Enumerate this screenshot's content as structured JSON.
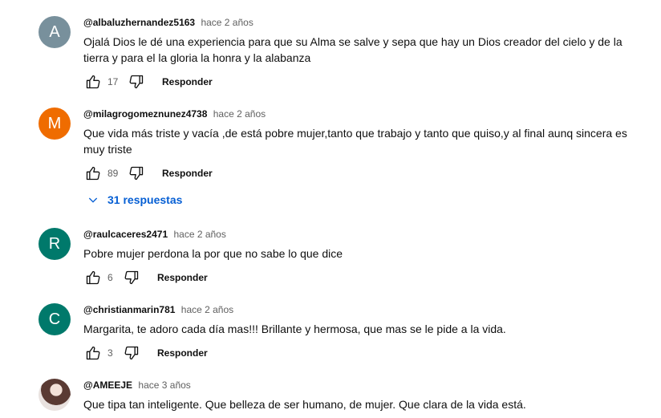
{
  "comments": [
    {
      "author": "@albaluzhernandez5163",
      "time": "hace 2 años",
      "text": "Ojalá Dios le dé una experiencia  para que su Alma se salve y sepa que hay un Dios creador del cielo y de la tierra y para el la gloria la honra y la alabanza",
      "avatar_letter": "A",
      "avatar_color": "#78909c",
      "likes": "17",
      "reply_label": "Responder"
    },
    {
      "author": "@milagrogomeznunez4738",
      "time": "hace 2 años",
      "text": "Que vida más  triste y vacía ,de está  pobre mujer,tanto que trabajo y tanto que quiso,y al final aunq sincera es muy triste",
      "avatar_letter": "M",
      "avatar_color": "#ef6c00",
      "likes": "89",
      "reply_label": "Responder",
      "replies_label": "31 respuestas"
    },
    {
      "author": "@raulcaceres2471",
      "time": "hace 2 años",
      "text": "Pobre mujer perdona la por que no sabe lo que dice",
      "avatar_letter": "R",
      "avatar_color": "#00796b",
      "likes": "6",
      "reply_label": "Responder"
    },
    {
      "author": "@christianmarin781",
      "time": "hace 2 años",
      "text": "Margarita, te adoro cada día mas!!! Brillante y hermosa, que mas se le pide a la vida.",
      "avatar_letter": "C",
      "avatar_color": "#00796b",
      "likes": "3",
      "reply_label": "Responder"
    },
    {
      "author": "@AMEEJE",
      "time": "hace 3 años",
      "text": "Que tipa tan inteligente. Que belleza de ser humano, de mujer. Que clara de la vida está.",
      "avatar": "profile-photo"
    }
  ]
}
